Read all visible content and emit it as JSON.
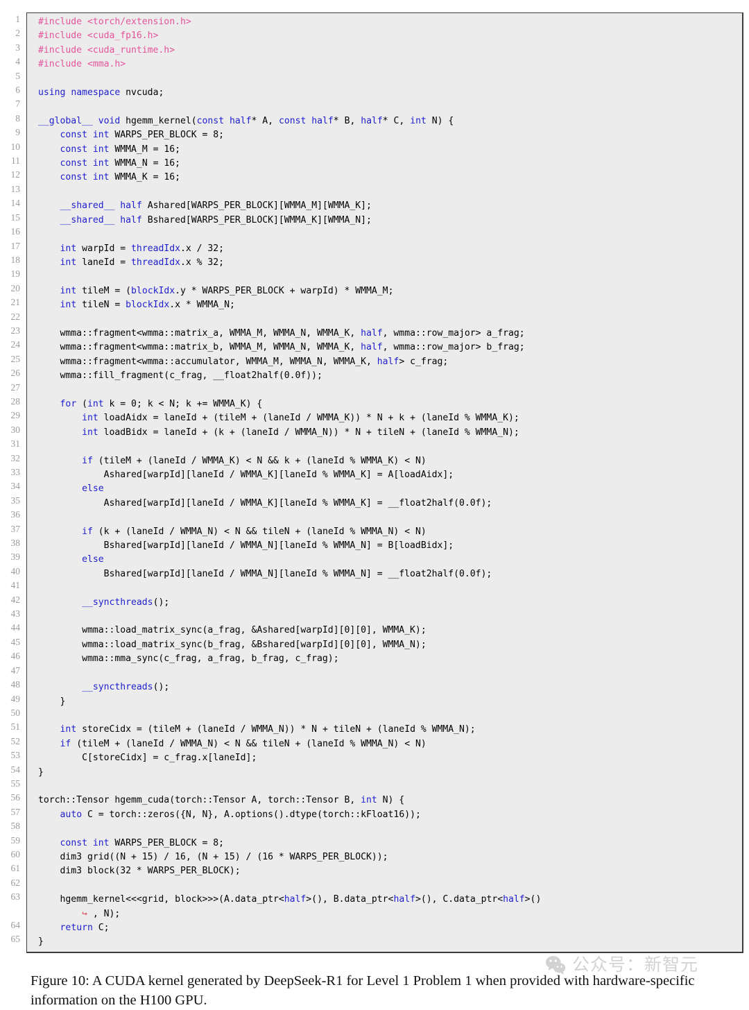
{
  "figure": {
    "caption": "Figure 10: A CUDA kernel generated by DeepSeek-R1 for Level 1 Problem 1 when provided with hardware-specific information on the H100 GPU."
  },
  "watermark": {
    "text": "公众号：新智元",
    "icon": "wechat-icon",
    "color": "#6e6e6e"
  },
  "listing": {
    "language": "CUDA C++",
    "background": "#ececec",
    "border_color": "#3c3c3c",
    "line_number_color": "#9b9b9b",
    "keyword_color": "#2020cf",
    "preprocessor_color": "#e5539b",
    "continuation_color": "#e04a5a",
    "first_line_number": 1,
    "last_line_number": 65,
    "line_numbers": [
      "1",
      "2",
      "3",
      "4",
      "5",
      "6",
      "7",
      "8",
      "9",
      "10",
      "11",
      "12",
      "13",
      "14",
      "15",
      "16",
      "17",
      "18",
      "19",
      "20",
      "21",
      "22",
      "23",
      "24",
      "25",
      "26",
      "27",
      "28",
      "29",
      "30",
      "31",
      "32",
      "33",
      "34",
      "35",
      "36",
      "37",
      "38",
      "39",
      "40",
      "41",
      "42",
      "43",
      "44",
      "45",
      "46",
      "47",
      "48",
      "49",
      "50",
      "51",
      "52",
      "53",
      "54",
      "55",
      "56",
      "57",
      "58",
      "59",
      "60",
      "61",
      "62",
      "63",
      "",
      "64",
      "65"
    ],
    "lines": [
      "#include <torch/extension.h>",
      "#include <cuda_fp16.h>",
      "#include <cuda_runtime.h>",
      "#include <mma.h>",
      "",
      "using namespace nvcuda;",
      "",
      "__global__ void hgemm_kernel(const half* A, const half* B, half* C, int N) {",
      "    const int WARPS_PER_BLOCK = 8;",
      "    const int WMMA_M = 16;",
      "    const int WMMA_N = 16;",
      "    const int WMMA_K = 16;",
      "",
      "    __shared__ half Ashared[WARPS_PER_BLOCK][WMMA_M][WMMA_K];",
      "    __shared__ half Bshared[WARPS_PER_BLOCK][WMMA_K][WMMA_N];",
      "",
      "    int warpId = threadIdx.x / 32;",
      "    int laneId = threadIdx.x % 32;",
      "",
      "    int tileM = (blockIdx.y * WARPS_PER_BLOCK + warpId) * WMMA_M;",
      "    int tileN = blockIdx.x * WMMA_N;",
      "",
      "    wmma::fragment<wmma::matrix_a, WMMA_M, WMMA_N, WMMA_K, half, wmma::row_major> a_frag;",
      "    wmma::fragment<wmma::matrix_b, WMMA_M, WMMA_N, WMMA_K, half, wmma::row_major> b_frag;",
      "    wmma::fragment<wmma::accumulator, WMMA_M, WMMA_N, WMMA_K, half> c_frag;",
      "    wmma::fill_fragment(c_frag, __float2half(0.0f));",
      "",
      "    for (int k = 0; k < N; k += WMMA_K) {",
      "        int loadAidx = laneId + (tileM + (laneId / WMMA_K)) * N + k + (laneId % WMMA_K);",
      "        int loadBidx = laneId + (k + (laneId / WMMA_N)) * N + tileN + (laneId % WMMA_N);",
      "",
      "        if (tileM + (laneId / WMMA_K) < N && k + (laneId % WMMA_K) < N)",
      "            Ashared[warpId][laneId / WMMA_K][laneId % WMMA_K] = A[loadAidx];",
      "        else",
      "            Ashared[warpId][laneId / WMMA_K][laneId % WMMA_K] = __float2half(0.0f);",
      "",
      "        if (k + (laneId / WMMA_N) < N && tileN + (laneId % WMMA_N) < N)",
      "            Bshared[warpId][laneId / WMMA_N][laneId % WMMA_N] = B[loadBidx];",
      "        else",
      "            Bshared[warpId][laneId / WMMA_N][laneId % WMMA_N] = __float2half(0.0f);",
      "",
      "        __syncthreads();",
      "",
      "        wmma::load_matrix_sync(a_frag, &Ashared[warpId][0][0], WMMA_K);",
      "        wmma::load_matrix_sync(b_frag, &Bshared[warpId][0][0], WMMA_N);",
      "        wmma::mma_sync(c_frag, a_frag, b_frag, c_frag);",
      "",
      "        __syncthreads();",
      "    }",
      "",
      "    int storeCidx = (tileM + (laneId / WMMA_N)) * N + tileN + (laneId % WMMA_N);",
      "    if (tileM + (laneId / WMMA_N) < N && tileN + (laneId % WMMA_N) < N)",
      "        C[storeCidx] = c_frag.x[laneId];",
      "}",
      "",
      "torch::Tensor hgemm_cuda(torch::Tensor A, torch::Tensor B, int N) {",
      "    auto C = torch::zeros({N, N}, A.options().dtype(torch::kFloat16));",
      "",
      "    const int WARPS_PER_BLOCK = 8;",
      "    dim3 grid((N + 15) / 16, (N + 15) / (16 * WARPS_PER_BLOCK));",
      "    dim3 block(32 * WARPS_PER_BLOCK);",
      "",
      "    hgemm_kernel<<<grid, block>>>(A.data_ptr<half>(), B.data_ptr<half>(), C.data_ptr<half>()",
      "        ↪ , N);",
      "    return C;",
      "}"
    ]
  }
}
